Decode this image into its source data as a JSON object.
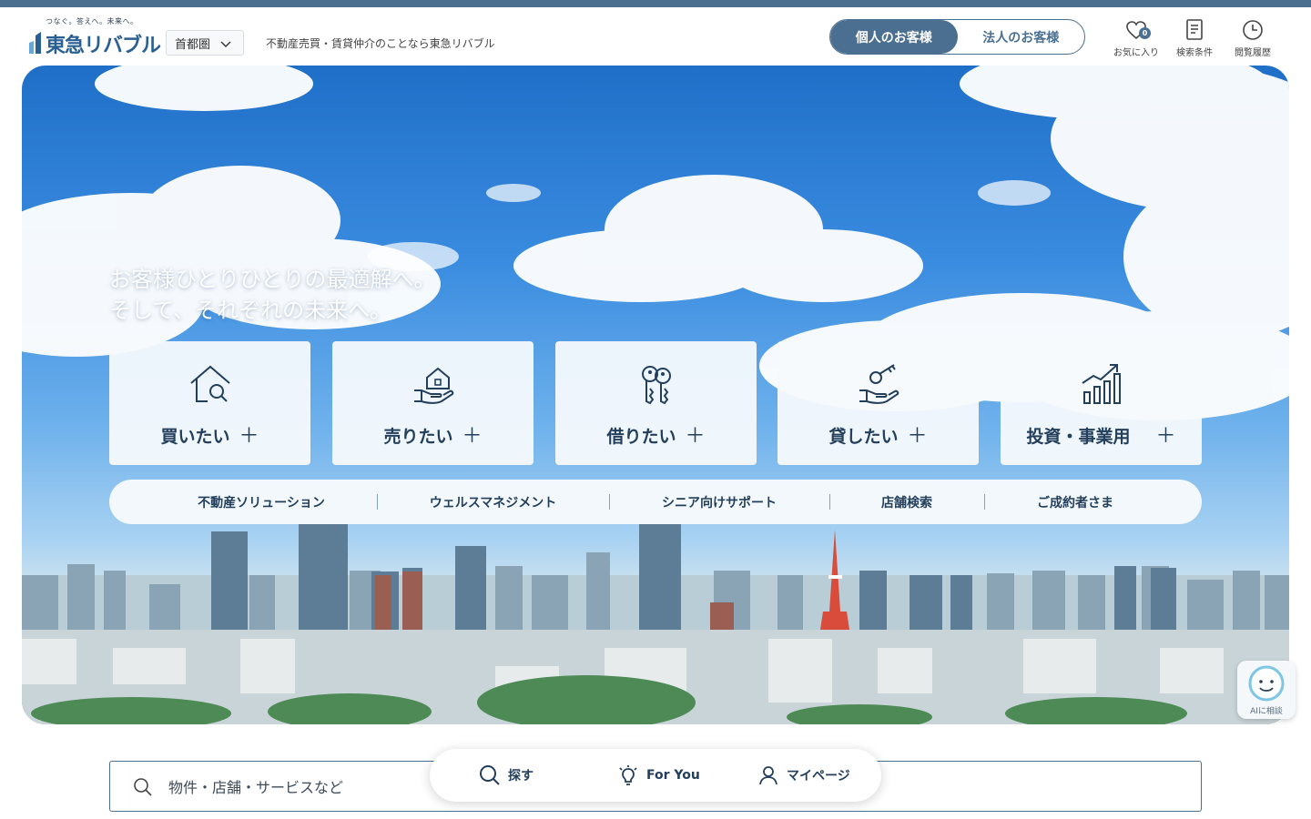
{
  "header": {
    "tagline": "つなぐ。答えへ。未来へ。",
    "brand": "東急リバブル",
    "region": "首都圏",
    "description": "不動産売買・賃貸仲介のことなら東急リバブル",
    "customer_tabs": [
      {
        "label": "個人のお客様",
        "active": true
      },
      {
        "label": "法人のお客様",
        "active": false
      }
    ],
    "icons": [
      {
        "name": "heart-icon",
        "label": "お気に入り",
        "badge": "0"
      },
      {
        "name": "document-icon",
        "label": "検索条件"
      },
      {
        "name": "clock-icon",
        "label": "閲覧履歴"
      }
    ]
  },
  "hero": {
    "copy_line1": "お客様ひとりひとりの最適解へ。",
    "copy_line2": "そして、それぞれの未来へ。",
    "categories": [
      {
        "label": "買いたい",
        "icon": "house-search-icon"
      },
      {
        "label": "売りたい",
        "icon": "house-hand-icon"
      },
      {
        "label": "借りたい",
        "icon": "keys-icon"
      },
      {
        "label": "貸したい",
        "icon": "key-hand-icon"
      },
      {
        "label": "投資・事業用",
        "icon": "bar-chart-icon"
      }
    ],
    "plus": "＋",
    "sub_links": [
      "不動産ソリューション",
      "ウェルスマネジメント",
      "シニア向けサポート",
      "店舗検索",
      "ご成約者さま"
    ]
  },
  "ai_button": {
    "label": "AIに相談"
  },
  "search": {
    "placeholder": "物件・店舗・サービスなど"
  },
  "bottom_nav": [
    {
      "label": "探す",
      "icon": "search-icon"
    },
    {
      "label": "For You",
      "icon": "lightbulb-icon"
    },
    {
      "label": "マイページ",
      "icon": "user-icon"
    }
  ],
  "colors": {
    "accent": "#4b6f90",
    "brand": "#2a5f93",
    "text": "#233f5c"
  }
}
